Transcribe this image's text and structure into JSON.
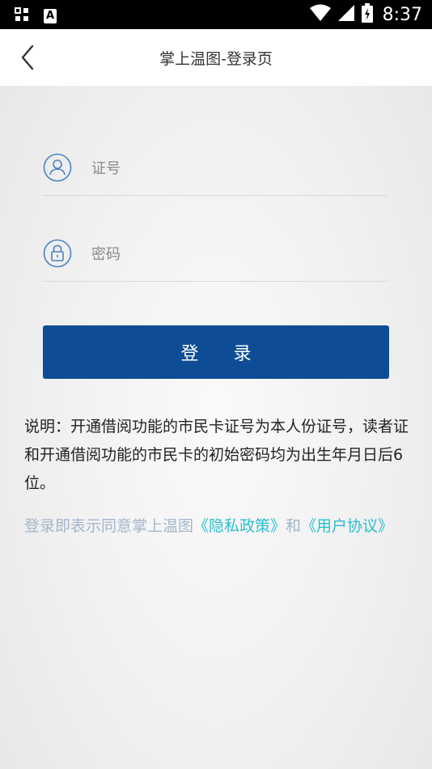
{
  "status_bar": {
    "time": "8:37",
    "notification_badge": "A"
  },
  "app_bar": {
    "title": "掌上温图-登录页"
  },
  "form": {
    "card_number_placeholder": "证号",
    "password_placeholder": "密码",
    "login_label": "登 录"
  },
  "notice": {
    "text": "说明：开通借阅功能的市民卡证号为本人份证号，读者证和开通借阅功能的市民卡的初始密码均为出生年月日后6位。"
  },
  "agreement": {
    "prefix": "登录即表示同意掌上温图",
    "privacy_link": "《隐私政策》",
    "conjunction": "和",
    "user_agreement_link": "《用户协议》"
  },
  "colors": {
    "primary": "#0e4d95",
    "link": "#28bfd0",
    "muted_text": "#a4b6cc",
    "icon": "#4a82c1"
  }
}
